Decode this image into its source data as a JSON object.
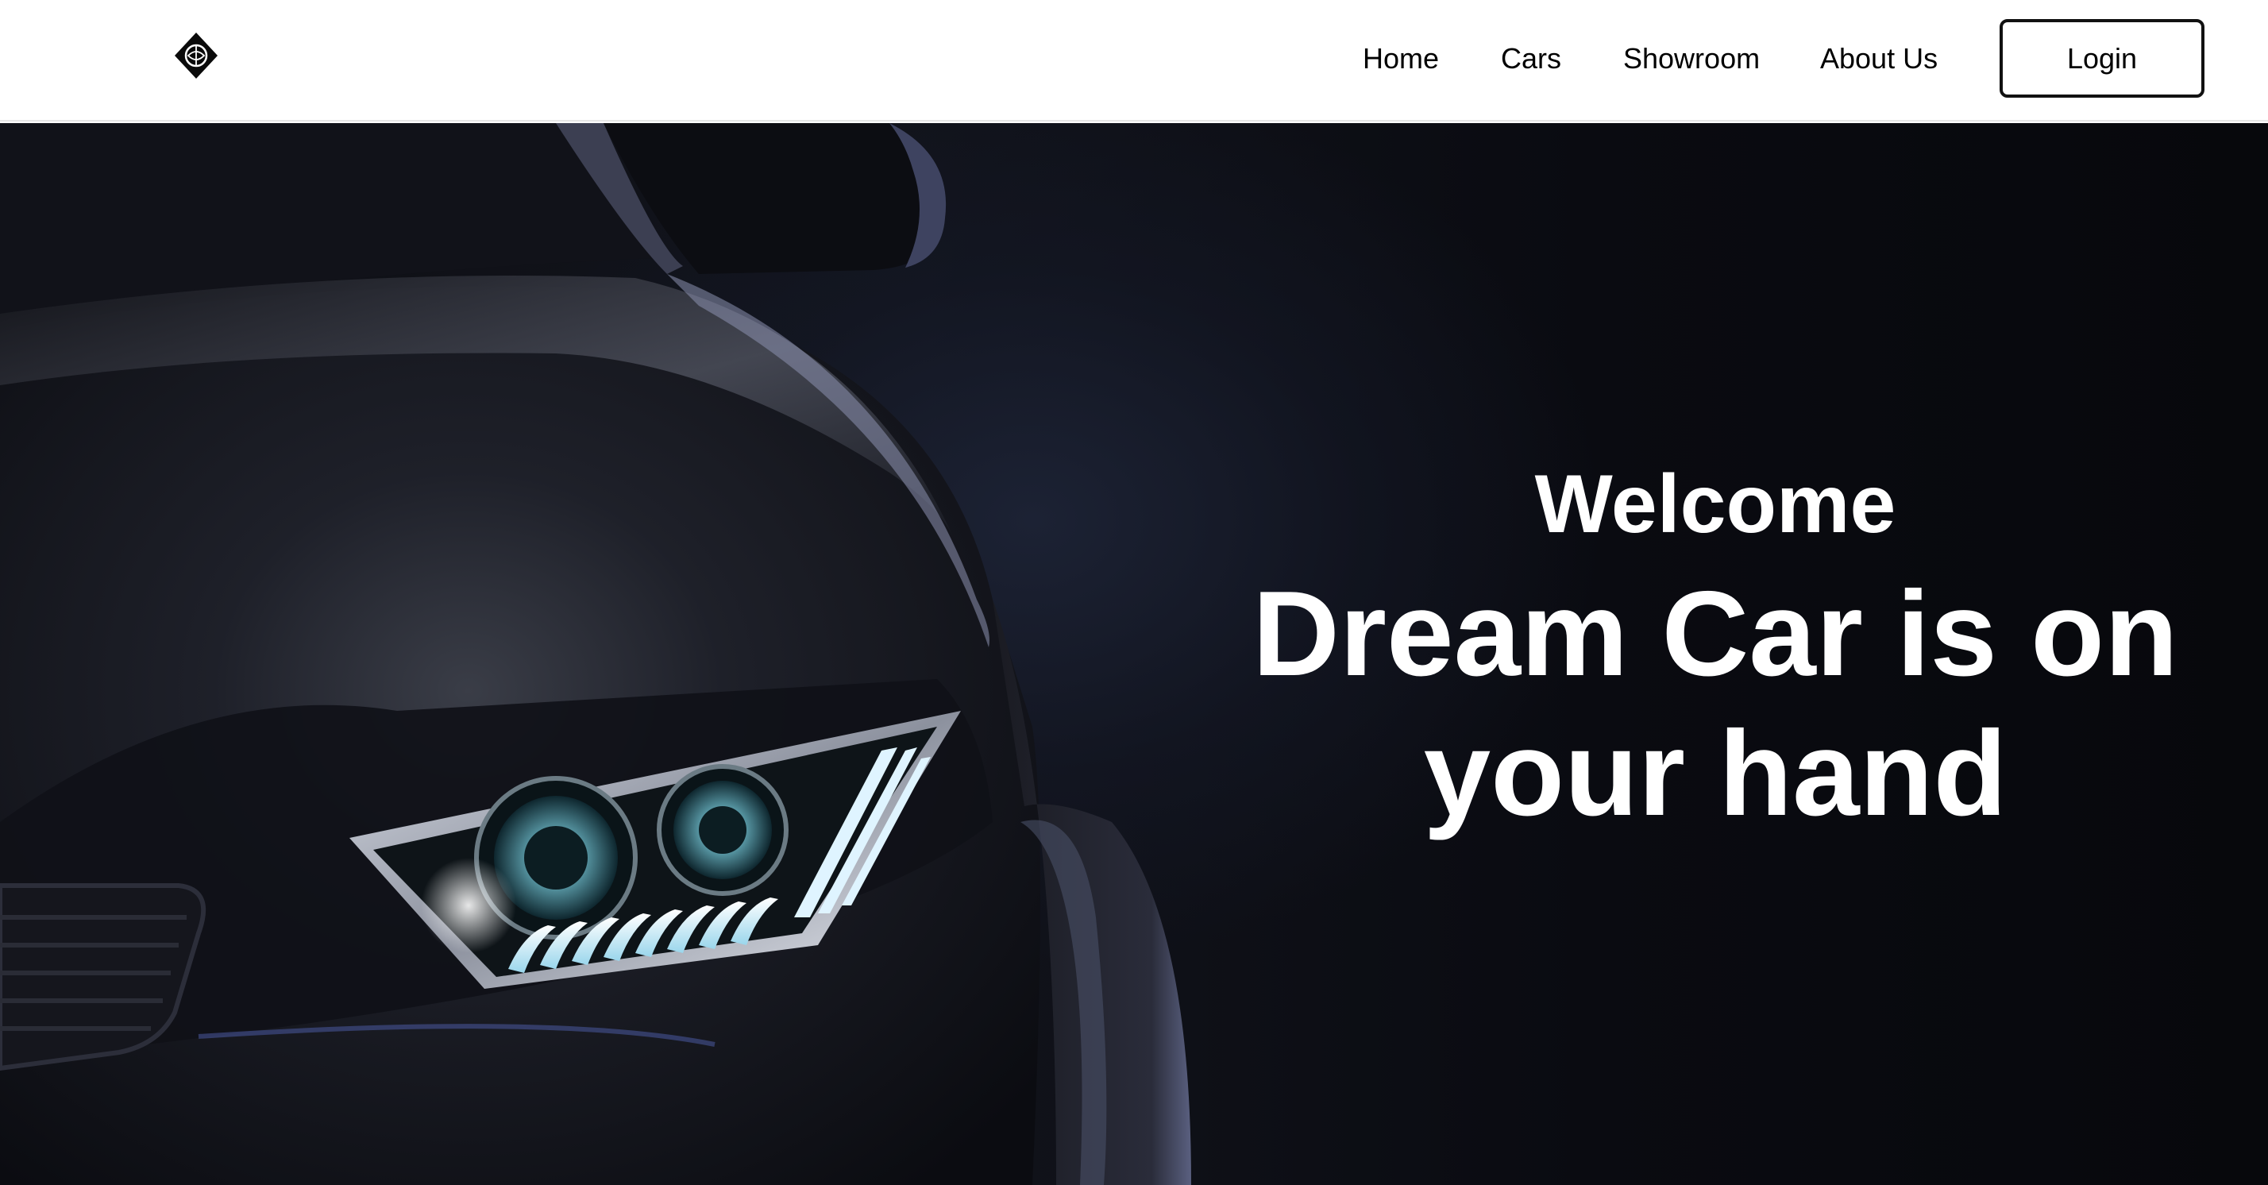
{
  "navbar": {
    "logo": {
      "icon": "diamond-emblem-icon"
    },
    "links": [
      {
        "label": "Home"
      },
      {
        "label": "Cars"
      },
      {
        "label": "Showroom"
      },
      {
        "label": "About Us"
      }
    ],
    "login_label": "Login"
  },
  "hero": {
    "image": "car-headlight-illustration",
    "welcome": "Welcome",
    "headline": "Dream Car is on your hand"
  },
  "colors": {
    "hero_background": "#0b0c12",
    "text_light": "#ffffff",
    "headlight_glow": "#bfe9ff"
  }
}
